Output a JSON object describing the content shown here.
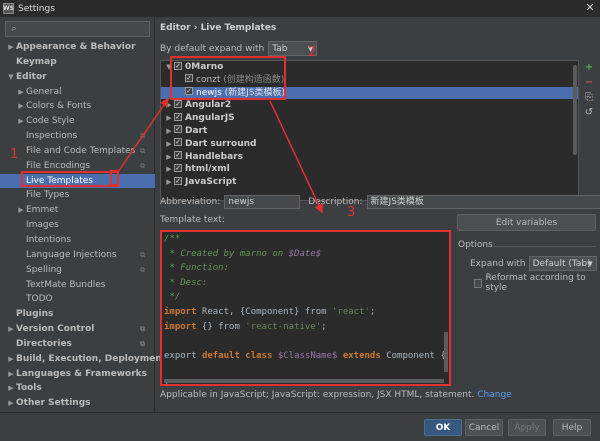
{
  "window": {
    "title": "Settings",
    "close_glyph": "✕"
  },
  "search": {
    "placeholder": ""
  },
  "nav": [
    {
      "label": "Appearance & Behavior",
      "arrow": "▶",
      "bold": true,
      "indent": 0
    },
    {
      "label": "Keymap",
      "arrow": "",
      "bold": true,
      "indent": 0
    },
    {
      "label": "Editor",
      "arrow": "▼",
      "bold": true,
      "indent": 0
    },
    {
      "label": "General",
      "arrow": "▶",
      "indent": 1
    },
    {
      "label": "Colors & Fonts",
      "arrow": "▶",
      "indent": 1
    },
    {
      "label": "Code Style",
      "arrow": "▶",
      "indent": 1
    },
    {
      "label": "Inspections",
      "arrow": "",
      "indent": 1,
      "proj": true
    },
    {
      "label": "File and Code Templates",
      "arrow": "",
      "indent": 1,
      "proj": true
    },
    {
      "label": "File Encodings",
      "arrow": "",
      "indent": 1,
      "proj": true
    },
    {
      "label": "Live Templates",
      "arrow": "",
      "indent": 1,
      "selected": true
    },
    {
      "label": "File Types",
      "arrow": "",
      "indent": 1
    },
    {
      "label": "Emmet",
      "arrow": "▶",
      "indent": 1
    },
    {
      "label": "Images",
      "arrow": "",
      "indent": 1
    },
    {
      "label": "Intentions",
      "arrow": "",
      "indent": 1
    },
    {
      "label": "Language Injections",
      "arrow": "",
      "indent": 1,
      "proj": true
    },
    {
      "label": "Spelling",
      "arrow": "",
      "indent": 1,
      "proj": true
    },
    {
      "label": "TextMate Bundles",
      "arrow": "",
      "indent": 1
    },
    {
      "label": "TODO",
      "arrow": "",
      "indent": 1
    },
    {
      "label": "Plugins",
      "arrow": "",
      "bold": true,
      "indent": 0
    },
    {
      "label": "Version Control",
      "arrow": "▶",
      "bold": true,
      "indent": 0,
      "proj": true
    },
    {
      "label": "Directories",
      "arrow": "",
      "bold": true,
      "indent": 0,
      "proj": true
    },
    {
      "label": "Build, Execution, Deployment",
      "arrow": "▶",
      "bold": true,
      "indent": 0
    },
    {
      "label": "Languages & Frameworks",
      "arrow": "▶",
      "bold": true,
      "indent": 0
    },
    {
      "label": "Tools",
      "arrow": "▶",
      "bold": true,
      "indent": 0
    },
    {
      "label": "Other Settings",
      "arrow": "▶",
      "bold": true,
      "indent": 0
    }
  ],
  "breadcrumb": "Editor › Live Templates",
  "expand_default": {
    "label": "By default expand with",
    "value": "Tab"
  },
  "tree": [
    {
      "arrow": "▼",
      "name": "0Marno",
      "bold": true,
      "indent": 0,
      "desc": ""
    },
    {
      "arrow": "",
      "name": "conzt",
      "desc": "(创建构造函数)",
      "indent": 1
    },
    {
      "arrow": "",
      "name": "newjs",
      "desc": "(新建JS类模板)",
      "indent": 1,
      "selected": true
    },
    {
      "arrow": "▶",
      "name": "Angular2",
      "bold": true,
      "indent": 0,
      "desc": ""
    },
    {
      "arrow": "▶",
      "name": "AngularJS",
      "bold": true,
      "indent": 0,
      "desc": ""
    },
    {
      "arrow": "▶",
      "name": "Dart",
      "bold": true,
      "indent": 0,
      "desc": ""
    },
    {
      "arrow": "▶",
      "name": "Dart surround",
      "bold": true,
      "indent": 0,
      "desc": ""
    },
    {
      "arrow": "▶",
      "name": "Handlebars",
      "bold": true,
      "indent": 0,
      "desc": ""
    },
    {
      "arrow": "▶",
      "name": "html/xml",
      "bold": true,
      "indent": 0,
      "desc": ""
    },
    {
      "arrow": "▶",
      "name": "JavaScript",
      "bold": true,
      "indent": 0,
      "desc": ""
    }
  ],
  "tree_tools": [
    "+",
    "−",
    "⎘",
    "↺"
  ],
  "abbreviation": {
    "label": "Abbreviation:",
    "value": "newjs"
  },
  "description": {
    "label": "Description:",
    "value": "新建JS类模板"
  },
  "template_text_label": "Template text:",
  "edit_variables": "Edit variables",
  "code": [
    [
      {
        "t": "/**",
        "c": "c-com"
      }
    ],
    [
      {
        "t": " * Created by marno on ",
        "c": "c-com"
      },
      {
        "t": "$Date$",
        "c": "c-dollar"
      }
    ],
    [
      {
        "t": " * Function:",
        "c": "c-com"
      }
    ],
    [
      {
        "t": " * Desc:",
        "c": "c-com"
      }
    ],
    [
      {
        "t": " */",
        "c": "c-com"
      }
    ],
    [
      {
        "t": "import",
        "c": "c-kw"
      },
      {
        "t": " React, {Component} from ",
        "c": ""
      },
      {
        "t": "'react'",
        "c": "c-str"
      },
      {
        "t": ";",
        "c": ""
      }
    ],
    [
      {
        "t": "import",
        "c": "c-kw"
      },
      {
        "t": " {} from ",
        "c": ""
      },
      {
        "t": "'react-native'",
        "c": "c-str"
      },
      {
        "t": ";",
        "c": ""
      }
    ],
    [
      {
        "t": "",
        "c": ""
      }
    ],
    [
      {
        "t": "export ",
        "c": ""
      },
      {
        "t": "default class",
        "c": "c-kw"
      },
      {
        "t": " ",
        "c": ""
      },
      {
        "t": "$ClassName$",
        "c": "c-var"
      },
      {
        "t": " ",
        "c": ""
      },
      {
        "t": "extends",
        "c": "c-kw"
      },
      {
        "t": " Component {",
        "c": ""
      }
    ],
    [
      {
        "t": "",
        "c": ""
      }
    ],
    [
      {
        "t": "}",
        "c": ""
      }
    ]
  ],
  "options": {
    "title": "Options",
    "expand_label": "Expand with",
    "expand_value": "Default (Tab)",
    "reformat_label": "Reformat according to style"
  },
  "applicable": {
    "text": "Applicable in JavaScript; JavaScript: expression, JSX HTML, statement.",
    "link": "Change"
  },
  "buttons": {
    "ok": "OK",
    "cancel": "Cancel",
    "apply": "Apply",
    "help": "Help"
  },
  "annotations": {
    "n1": "1",
    "n2": "2",
    "n3": "3",
    "color": "#e03030"
  }
}
